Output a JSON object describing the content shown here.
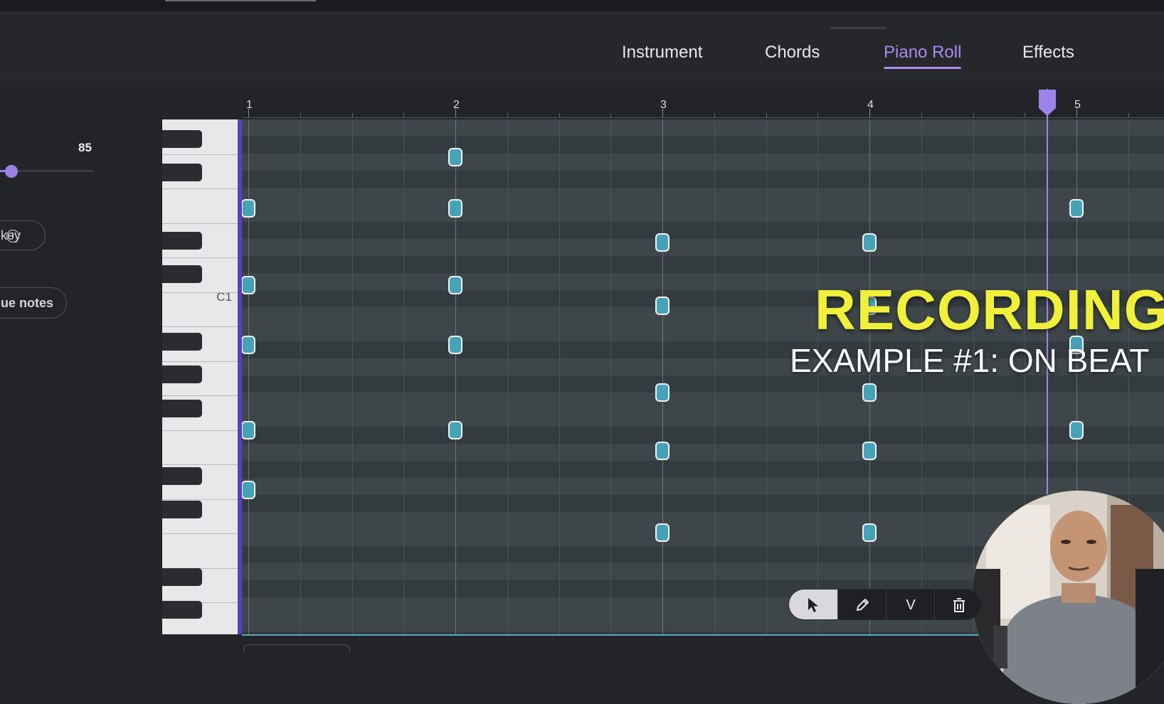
{
  "tabs": [
    {
      "label": "Instrument",
      "active": false
    },
    {
      "label": "Chords",
      "active": false
    },
    {
      "label": "Piano Roll",
      "active": true
    },
    {
      "label": "Effects",
      "active": false
    }
  ],
  "left_panel": {
    "velocity_value": "85",
    "velocity_level": 0.12,
    "key_pill_label": "key",
    "notes_pill_label": "ue notes"
  },
  "keyboard": {
    "c1_label": "C1"
  },
  "ruler": {
    "bars": [
      "1",
      "2",
      "3",
      "4",
      "5"
    ]
  },
  "playhead": {
    "position_bar": 4.86
  },
  "notes": [
    {
      "bar": 2,
      "row": 2
    },
    {
      "bar": 1,
      "row": 5
    },
    {
      "bar": 2,
      "row": 5
    },
    {
      "bar": 5,
      "row": 5
    },
    {
      "bar": 3,
      "row": 7
    },
    {
      "bar": 4,
      "row": 7
    },
    {
      "bar": 1,
      "row": 9.5
    },
    {
      "bar": 2,
      "row": 9.5
    },
    {
      "bar": 3,
      "row": 10.7
    },
    {
      "bar": 4,
      "row": 10.7
    },
    {
      "bar": 1,
      "row": 13
    },
    {
      "bar": 2,
      "row": 13
    },
    {
      "bar": 5,
      "row": 13
    },
    {
      "bar": 3,
      "row": 15.8
    },
    {
      "bar": 4,
      "row": 15.8
    },
    {
      "bar": 1,
      "row": 18
    },
    {
      "bar": 2,
      "row": 18
    },
    {
      "bar": 5,
      "row": 18
    },
    {
      "bar": 3,
      "row": 19.2
    },
    {
      "bar": 4,
      "row": 19.2
    },
    {
      "bar": 1,
      "row": 21.5
    },
    {
      "bar": 3,
      "row": 24
    },
    {
      "bar": 4,
      "row": 24
    }
  ],
  "overlay": {
    "title": "RECORDING",
    "subtitle": "EXAMPLE #1: ON BEAT"
  },
  "toolbar": {
    "tools": [
      {
        "name": "select-tool",
        "icon": "cursor-arrow-icon",
        "label": "",
        "selected": true
      },
      {
        "name": "pencil-tool",
        "icon": "pencil-icon",
        "label": "",
        "selected": false
      },
      {
        "name": "velocity-tool",
        "icon": "",
        "label": "V",
        "selected": false
      },
      {
        "name": "delete-tool",
        "icon": "trash-icon",
        "label": "",
        "selected": false
      }
    ]
  },
  "colors": {
    "accent": "#a98cf0",
    "note_fill": "#45a3b8",
    "overlay_title": "#f0f03a",
    "grid_bg": "#3c4448"
  }
}
